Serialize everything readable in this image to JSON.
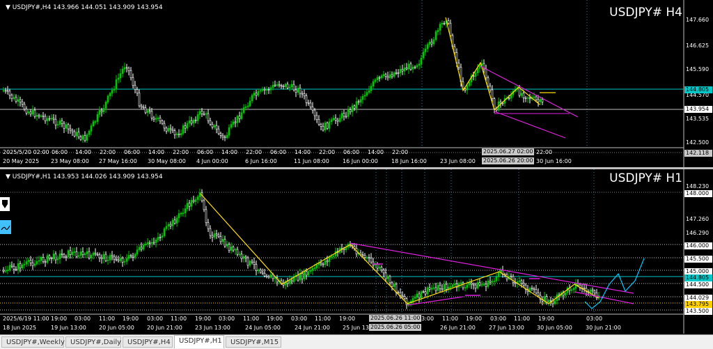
{
  "top": {
    "info": "▼ USDJPY#,H4  143.966 144.051 143.909 143.954",
    "symbol_label": "USDJPY#  H4",
    "y_labels": [
      "147.660",
      "146.625",
      "145.590",
      "144.570",
      "143.535",
      "142.500"
    ],
    "price_boxes": [
      {
        "text": "144.805",
        "color": "#00c8c8"
      },
      {
        "text": "143.954",
        "color": "#ffffff"
      },
      {
        "text": "142.118",
        "color": "#c8c8c8"
      }
    ],
    "x_labels_upper": [
      "2025/5/20 02:00",
      "06:00",
      "14:00",
      "22:00",
      "06:00",
      "14:00",
      "22:00",
      "06:00",
      "14:00",
      "22:00",
      "06:00",
      "14:00",
      "22:00",
      "06:00",
      "14:00",
      "22:00",
      "22:00"
    ],
    "x_labels": [
      "20 May 2025",
      "23 May 08:00",
      "27 May 16:00",
      "30 May 08:00",
      "4 Jun 00:00",
      "6 Jun 16:00",
      "11 Jun 08:00",
      "16 Jun 00:00",
      "18 Jun 16:00",
      "23 Jun 08:00",
      "30 Jun 16:00"
    ],
    "x_box_upper": "2025.06.27 02:00",
    "x_box_lower": "2025.06.26 20:00"
  },
  "bottom": {
    "info": "▼ USDJPY#,H1  143.953 144.026 143.909 143.954",
    "symbol_label": "USDJPY#  H1",
    "y_labels": [
      "148.230",
      "147.260",
      "146.290"
    ],
    "price_boxes": [
      {
        "text": "148.000",
        "color": "#ffffff"
      },
      {
        "text": "146.000",
        "color": "#ffffff"
      },
      {
        "text": "145.500",
        "color": "#ffffff"
      },
      {
        "text": "145.000",
        "color": "#ffffff"
      },
      {
        "text": "144.805",
        "color": "#00c8c8"
      },
      {
        "text": "144.500",
        "color": "#ffffff"
      },
      {
        "text": "144.029",
        "color": "#ffffff"
      },
      {
        "text": "143.795",
        "color": "#ffd000"
      },
      {
        "text": "143.500",
        "color": "#ffffff"
      }
    ],
    "x_labels": [
      "18 Jun 2025",
      "19 Jun 13:00",
      "20 Jun 05:00",
      "20 Jun 21:00",
      "23 Jun 13:00",
      "24 Jun 05:00",
      "24 Jun 21:00",
      "25 Jun 13:00",
      "26 Jun 21:00",
      "27 Jun 13:00",
      "30 Jun 05:00",
      "30 Jun 21:00"
    ],
    "x_labels_upper": [
      "2025/6/19 11:00",
      "19:00",
      "03:00",
      "11:00",
      "19:00",
      "03:00",
      "11:00",
      "19:00",
      "03:00",
      "11:00",
      "19:00",
      "03:00",
      "11:00",
      "19:00",
      "03:00",
      "11:00",
      "19:00",
      "03:00",
      "11:00",
      "19:00",
      "03:00"
    ],
    "x_box_upper": "2025.06.26 11:00",
    "x_box_lower": "2025.06.26 05:00"
  },
  "tabs": [
    {
      "label": "USDJPY#,Weekly",
      "active": false
    },
    {
      "label": "USDJPY#,Daily",
      "active": false
    },
    {
      "label": "USDJPY#,H4",
      "active": false
    },
    {
      "label": "USDJPY#,H1",
      "active": true
    },
    {
      "label": "USDJPY#,M15",
      "active": false
    }
  ],
  "colors": {
    "bull_candle": "#00c800",
    "bear_candle": "#ffffff",
    "zigzag": "#ffe000",
    "channel": "#e020e0",
    "forecast": "#00c8ff",
    "level_line": "#00c8c8"
  }
}
